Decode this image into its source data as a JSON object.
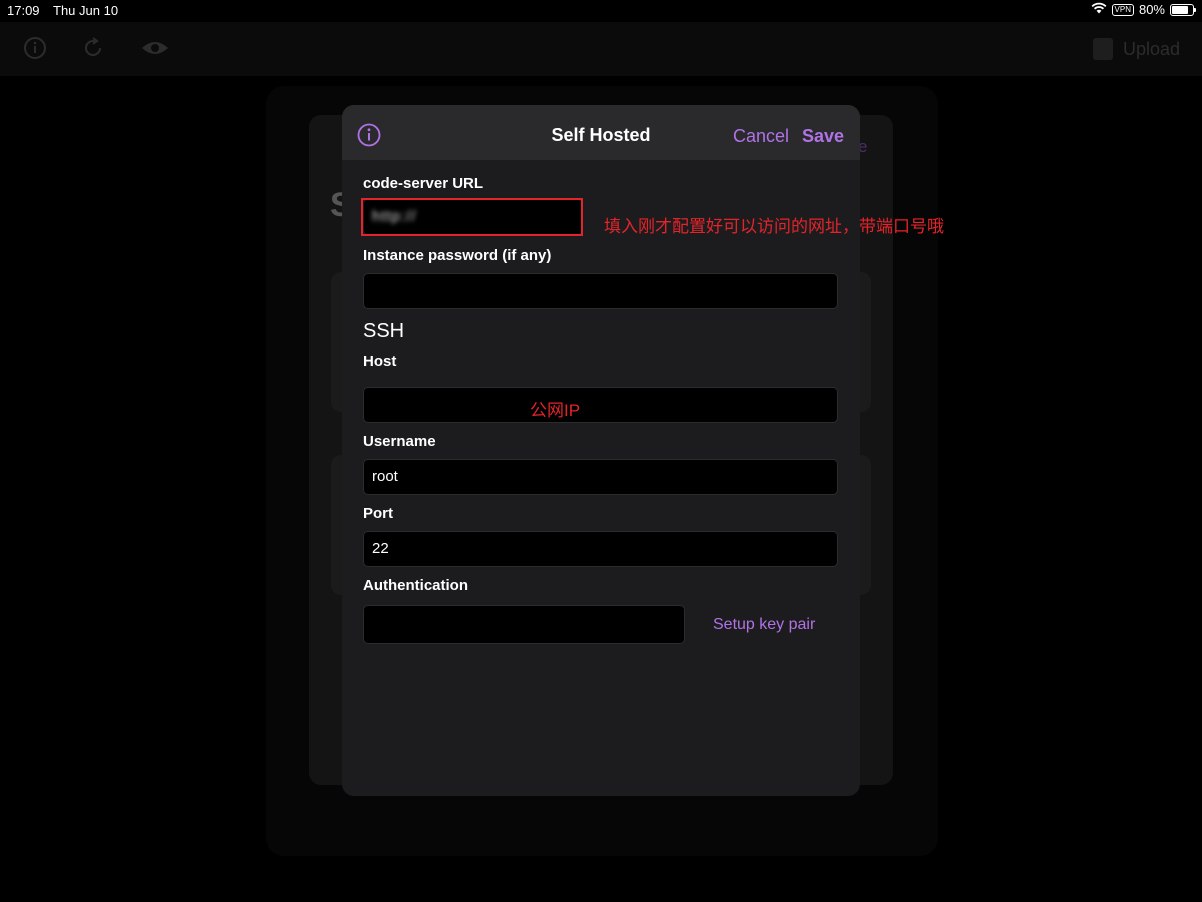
{
  "status_bar": {
    "time": "17:09",
    "date": "Thu Jun 10",
    "vpn": "VPN",
    "battery": "80%",
    "battery_level": 0.8
  },
  "background": {
    "toolbar_upload_label": "Upload",
    "title_initial": "S",
    "header_fragment": "e"
  },
  "modal": {
    "title": "Self Hosted",
    "cancel_label": "Cancel",
    "save_label": "Save",
    "fields": {
      "url_label": "code-server URL",
      "url_value": "http://",
      "password_label": "Instance password (if any)",
      "password_value": "",
      "ssh_section": "SSH",
      "host_label": "Host",
      "host_value": "",
      "username_label": "Username",
      "username_value": "root",
      "port_label": "Port",
      "port_value": "22",
      "auth_label": "Authentication",
      "auth_value": ""
    },
    "setup_key_label": "Setup key pair"
  },
  "annotations": {
    "url_note": "填入刚才配置好可以访问的网址，带端口号哦",
    "host_note": "公网IP"
  },
  "colors": {
    "accent": "#b073e6",
    "annotation": "#e3242b",
    "modal_bg": "#1c1c1e",
    "modal_header_bg": "#2a2a2c"
  }
}
